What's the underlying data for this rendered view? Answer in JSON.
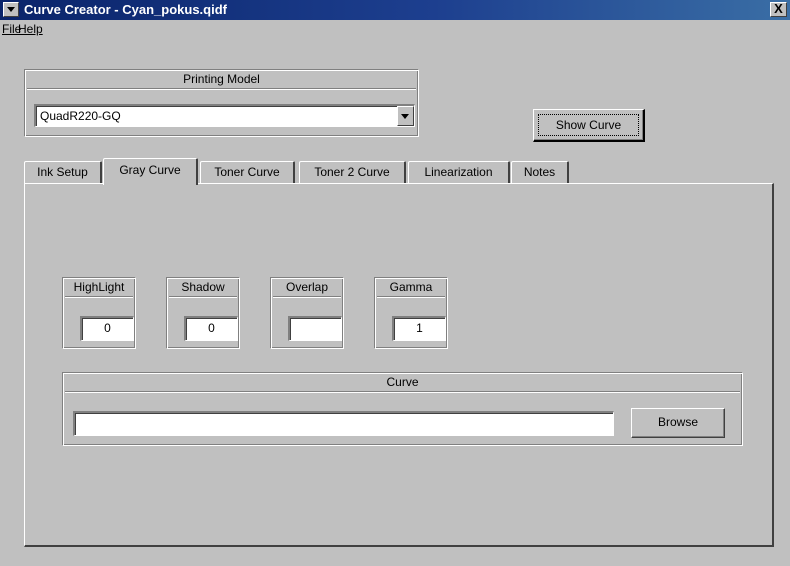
{
  "window": {
    "title": "Curve Creator - Cyan_pokus.qidf",
    "close_label": "X"
  },
  "menu": {
    "file": "File",
    "help": "Help"
  },
  "printing_model": {
    "header": "Printing Model",
    "selected": "QuadR220-GQ"
  },
  "show_curve_label": "Show Curve",
  "tabs": [
    {
      "label": "Ink Setup"
    },
    {
      "label": "Gray Curve",
      "active": true
    },
    {
      "label": "Toner Curve"
    },
    {
      "label": "Toner 2 Curve"
    },
    {
      "label": "Linearization"
    },
    {
      "label": "Notes"
    }
  ],
  "params": {
    "highlight": {
      "label": "HighLight",
      "value": "0"
    },
    "shadow": {
      "label": "Shadow",
      "value": "0"
    },
    "overlap": {
      "label": "Overlap",
      "value": ""
    },
    "gamma": {
      "label": "Gamma",
      "value": "1"
    }
  },
  "curve": {
    "header": "Curve",
    "path_value": "",
    "browse_label": "Browse"
  }
}
